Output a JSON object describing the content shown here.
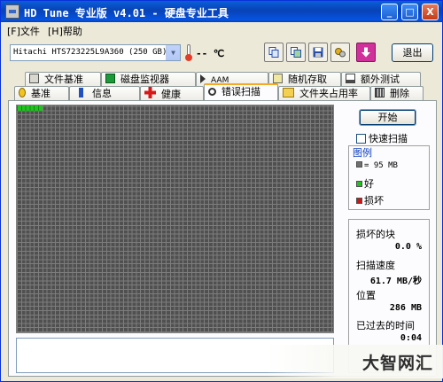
{
  "window": {
    "title": "HD Tune  专业版  v4.01  -  硬盘专业工具"
  },
  "window_buttons": {
    "minimize": "_",
    "maximize": "□",
    "close": "X"
  },
  "menu": [
    {
      "label": "[F]文件"
    },
    {
      "label": "[H]帮助"
    }
  ],
  "toolbar": {
    "drive": "Hitachi HTS723225L9A360   (250 GB)",
    "temperature": "-- ℃",
    "exit_label": "退出",
    "icons": [
      "copy-text-icon",
      "copy-screenshot-icon",
      "save-icon",
      "options-icon",
      "download-icon"
    ]
  },
  "tabs_top": [
    {
      "label": "文件基准",
      "icon": "benchmark-icon"
    },
    {
      "label": "磁盘监视器",
      "icon": "monitor-icon"
    },
    {
      "label": "AAM",
      "icon": "speaker-icon"
    },
    {
      "label": "随机存取",
      "icon": "random-access-icon"
    },
    {
      "label": "额外测试",
      "icon": "extra-tests-icon"
    }
  ],
  "tabs_bottom": [
    {
      "label": "基准",
      "icon": "benchmark-icon"
    },
    {
      "label": "信息",
      "icon": "info-icon"
    },
    {
      "label": "健康",
      "icon": "health-cross-icon"
    },
    {
      "label": "错误扫描",
      "icon": "magnifier-icon"
    },
    {
      "label": "文件夹占用率",
      "icon": "folder-icon"
    },
    {
      "label": "删除",
      "icon": "trash-icon"
    }
  ],
  "error_scan": {
    "start_label": "开始",
    "quick_scan_label": "快速扫描",
    "quick_scan_checked": false,
    "progress_fraction": 0.08,
    "legend": {
      "title": "图例",
      "block_size": "= 95 MB",
      "good_label": "好",
      "bad_label": "损坏",
      "colors": {
        "block": "#707070",
        "good": "#21c121",
        "bad": "#c81818"
      }
    },
    "stats": {
      "damaged_label": "损坏的块",
      "damaged_value": "0.0 %",
      "speed_label": "扫描速度",
      "speed_value": "61.7 MB/秒",
      "position_label": "位置",
      "position_value": "286 MB",
      "elapsed_label": "已过去的时间",
      "elapsed_value": "0:04"
    }
  },
  "watermark": "大智网汇"
}
